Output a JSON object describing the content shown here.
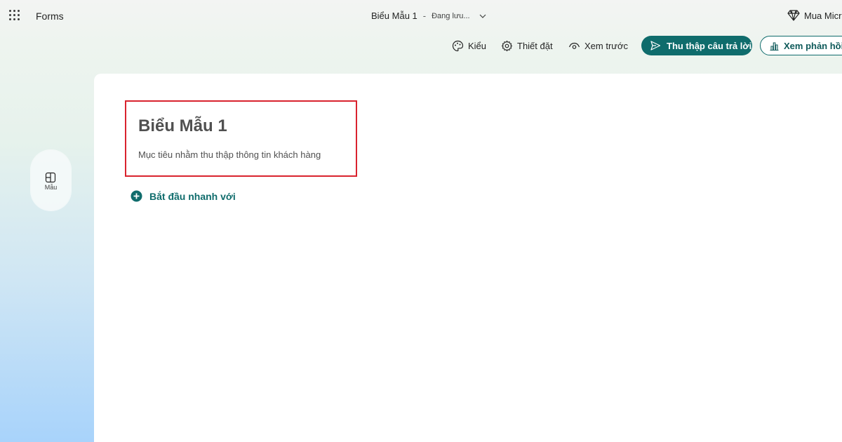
{
  "app": {
    "name": "Forms"
  },
  "document": {
    "title": "Biểu Mẫu 1",
    "separator": "-",
    "status": "Đang lưu..."
  },
  "header": {
    "buy_label": "Mua Micro"
  },
  "toolbar": {
    "style_label": "Kiểu",
    "settings_label": "Thiết đặt",
    "preview_label": "Xem trước",
    "collect_label": "Thu thập câu trả lời",
    "responses_label": "Xem phản hồi"
  },
  "rail": {
    "templates_label": "Mẫu"
  },
  "form": {
    "title": "Biểu Mẫu 1",
    "description": "Mục tiêu nhằm thu thập thông tin khách hàng",
    "quick_start_label": "Bắt đầu nhanh với"
  },
  "icons": {
    "app_launcher": "waffle-icon",
    "chevron": "chevron-down-icon",
    "premium": "diamond-icon",
    "style": "palette-icon",
    "settings": "gear-icon",
    "preview": "eye-icon",
    "collect": "send-icon",
    "responses": "chart-icon",
    "templates": "layout-icon",
    "quick_start": "add-circle-icon"
  },
  "colors": {
    "accent": "#0f6c6c",
    "highlight_border": "#d9232e",
    "canvas": "#ffffff"
  }
}
